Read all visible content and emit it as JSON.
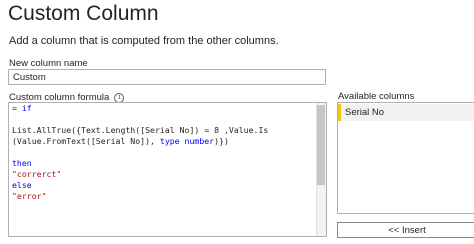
{
  "dialog": {
    "title": "Custom Column",
    "subtitle": "Add a column that is computed from the other columns."
  },
  "new_column": {
    "label": "New column name",
    "value": "Custom"
  },
  "formula": {
    "label": "Custom column formula",
    "info_icon": "info-icon",
    "lines": [
      [
        {
          "t": "= ",
          "c": "op"
        },
        {
          "t": "if",
          "c": "kw"
        }
      ],
      [],
      [
        {
          "t": "List.AllTrue({Text.Length([Serial No]) = 8 ,Value.Is",
          "c": "op"
        }
      ],
      [
        {
          "t": "(Value.FromText([Serial No]), ",
          "c": "op"
        },
        {
          "t": "type number",
          "c": "kw"
        },
        {
          "t": ")})",
          "c": "op"
        }
      ],
      [],
      [
        {
          "t": "then",
          "c": "kw"
        }
      ],
      [
        {
          "t": "\"correrct\"",
          "c": "str"
        }
      ],
      [
        {
          "t": "else",
          "c": "kw"
        }
      ],
      [
        {
          "t": "\"error\"",
          "c": "str"
        }
      ]
    ]
  },
  "available_columns": {
    "label": "Available columns",
    "items": [
      "Serial No"
    ]
  },
  "insert_button": {
    "label": "<< Insert"
  },
  "colors": {
    "keyword": "#0000ff",
    "string": "#a31515",
    "selection_accent": "#f2c811"
  }
}
